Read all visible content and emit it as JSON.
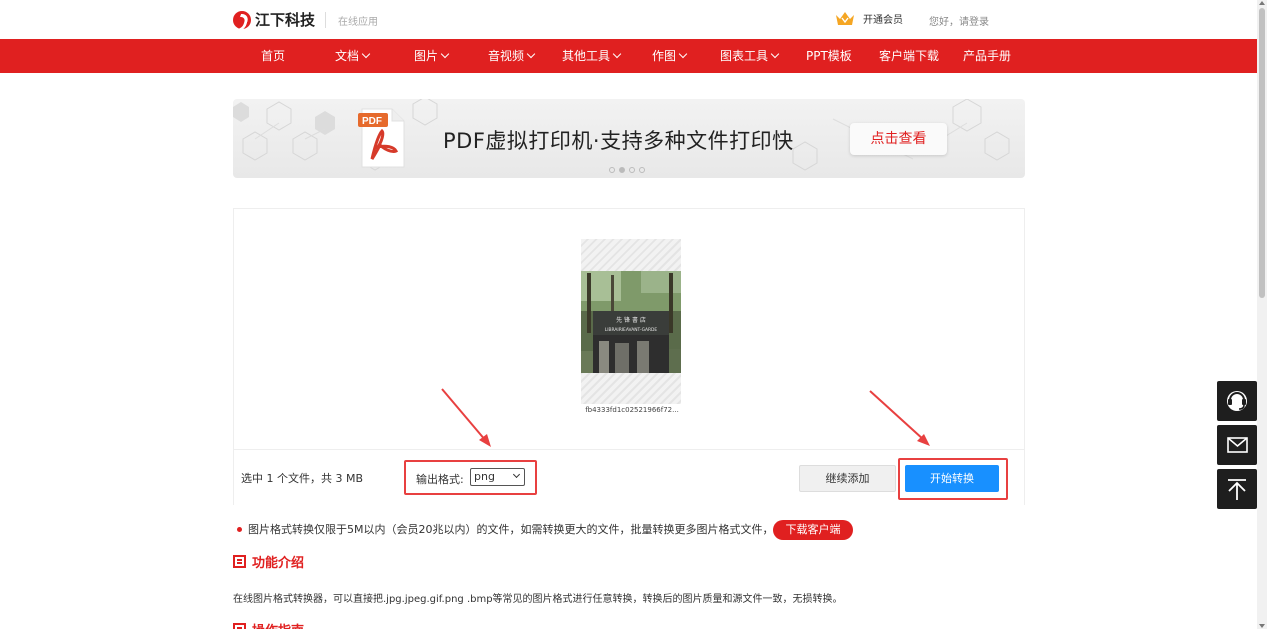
{
  "brand": {
    "name": "江下科技",
    "sub": "在线应用"
  },
  "header": {
    "vip_label": "开通会员",
    "login_label": "您好，请登录"
  },
  "nav": {
    "items": [
      {
        "label": "首页",
        "dropdown": false
      },
      {
        "label": "文档",
        "dropdown": true
      },
      {
        "label": "图片",
        "dropdown": true
      },
      {
        "label": "音视频",
        "dropdown": true
      },
      {
        "label": "其他工具",
        "dropdown": true
      },
      {
        "label": "作图",
        "dropdown": true
      },
      {
        "label": "图表工具",
        "dropdown": true
      },
      {
        "label": "PPT模板",
        "dropdown": false
      },
      {
        "label": "客户端下载",
        "dropdown": false
      },
      {
        "label": "产品手册",
        "dropdown": false
      }
    ]
  },
  "banner": {
    "icon_label": "PDF",
    "title": "PDF虚拟打印机·支持多种文件打印快",
    "button": "点击查看",
    "slides": 4,
    "active_slide": 2
  },
  "converter": {
    "file_name": "fb4333fd1c02521966f72...",
    "thumb_sign_top": "先 锋 書 店",
    "thumb_sign_bottom": "LIBRAIRIEAVANT-GARDE",
    "selection_info": "选中 1 个文件，共 3 MB",
    "format_label": "输出格式:",
    "format_value": "png",
    "add_button": "继续添加",
    "start_button": "开始转换"
  },
  "notice": {
    "text": "图片格式转换仅限于5M以内（会员20兆以内）的文件，如需转换更大的文件，批量转换更多图片格式文件，请",
    "download_button": "下载客户端"
  },
  "sections": {
    "intro_title": "功能介绍",
    "intro_text": "在线图片格式转换器，可以直接把.jpg.jpeg.gif.png .bmp等常见的图片格式进行任意转换，转换后的图片质量和源文件一致，无损转换。",
    "guide_title": "操作指南"
  },
  "colors": {
    "brand_red": "#e02020",
    "primary_blue": "#1890ff",
    "highlight_red": "#e84040"
  }
}
